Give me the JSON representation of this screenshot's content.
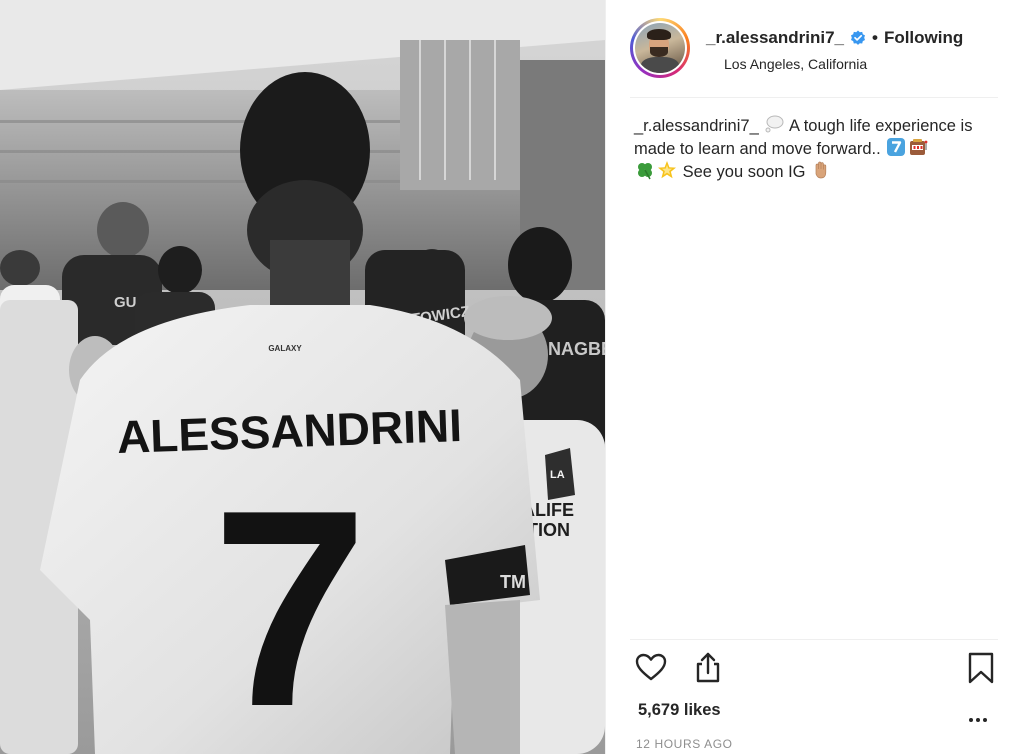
{
  "post": {
    "photo_icon": "post-photo",
    "photo_jersey_name": "ALESSANDRINI",
    "photo_jersey_number": "7",
    "photo_jersey_brand": "GALAXY",
    "photo_other_name": "ARENTOWICZ",
    "photo_other_name_right": "NAGBE",
    "photo_sleeve_text": "TM",
    "photo_kid_shirt_line1": "ALIFE",
    "photo_kid_shirt_line2": "ITION",
    "photo_kid_badge": "LA",
    "photo_fan_shirt": "GU"
  },
  "header": {
    "username": "_r.alessandrini7_",
    "verified_icon": "verified-badge-icon",
    "separator": "•",
    "follow_state": "Following",
    "location": "Los Angeles, California"
  },
  "caption": {
    "username": "_r.alessandrini7_",
    "text_part1": " A tough life experience is made to learn and move forward.. ",
    "text_part2": " See you soon IG ",
    "emojis": [
      "thought-balloon",
      "keycap-seven",
      "slot-machine",
      "four-leaf-clover",
      "glowing-star",
      "waving-hand"
    ]
  },
  "actions": {
    "like_icon": "heart-icon",
    "share_icon": "share-icon",
    "save_icon": "bookmark-icon",
    "more_icon": "more-icon"
  },
  "stats": {
    "likes": "5,679 likes",
    "time_ago": "12 HOURS AGO"
  },
  "colors": {
    "text": "#262626",
    "muted": "#8e8e8e",
    "verified": "#3897f0",
    "border": "#efefef"
  }
}
